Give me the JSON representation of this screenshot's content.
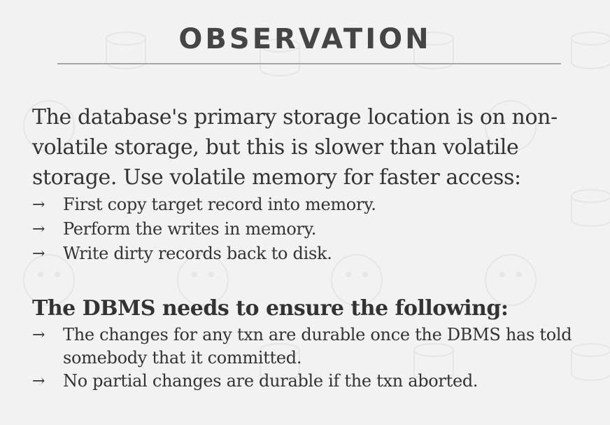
{
  "slide": {
    "title": "OBSERVATION",
    "intro": "The database's primary storage location is on non-volatile storage, but this is slower than volatile storage. Use volatile memory for faster access:",
    "arrow_glyph": "→",
    "steps": [
      {
        "text": "First copy target record into memory."
      },
      {
        "text": "Perform the writes in memory."
      },
      {
        "text": "Write dirty records back to disk."
      }
    ],
    "requirements_heading": "The DBMS needs to ensure the following:",
    "requirements": [
      {
        "text": "The changes for any txn are durable once the DBMS has told somebody that it committed."
      },
      {
        "text": "No partial changes are durable if the txn aborted."
      }
    ]
  },
  "colors": {
    "background": "#f2f2f2",
    "title": "#454545",
    "text": "#333333",
    "rule": "#a6a6a6"
  }
}
